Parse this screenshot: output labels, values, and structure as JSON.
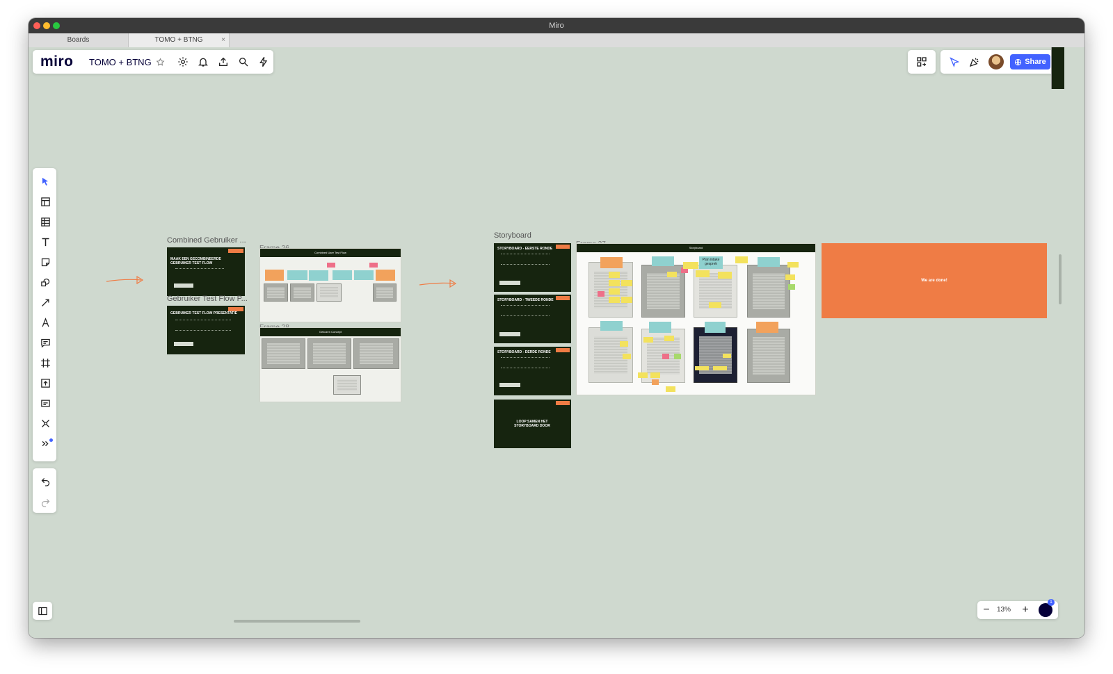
{
  "window": {
    "title": "Miro"
  },
  "tabs": [
    {
      "label": "Boards",
      "active": false
    },
    {
      "label": "TOMO + BTNG",
      "active": true,
      "close": "×"
    }
  ],
  "header": {
    "logo": "miro",
    "board_name": "TOMO + BTNG",
    "icons": [
      "star-icon",
      "settings-icon",
      "bell-icon",
      "upload-icon",
      "search-icon",
      "magic-icon"
    ]
  },
  "top_right": {
    "share_label": "Share",
    "icons": [
      "apps-icon",
      "cursor-arrow-icon",
      "celebrate-icon",
      "avatar",
      "globe-icon"
    ]
  },
  "toolbar": {
    "tools": [
      "select-icon",
      "templates-icon",
      "table-icon",
      "text-icon",
      "sticky-note-icon",
      "shapes-icon",
      "connector-icon",
      "pen-icon",
      "comment-icon",
      "frame-icon",
      "upload-icon",
      "card-icon",
      "mindmap-icon",
      "more-tools-icon"
    ],
    "undo": "undo-icon",
    "redo": "redo-icon"
  },
  "canvas": {
    "frame1_label": "Combined Gebruiker ...",
    "slide1_title": "MAAK EEN GECOMBINEERDE GEBRUIKER TEST FLOW",
    "frame2_label": "Gebruiker Test Flow P...",
    "slide2_title": "GEBRUIKER TEST FLOW PRESENTATIE",
    "frame26_label": "Frame 26",
    "frame26_header": "Combined User Test Flow",
    "frame28_label": "Frame 28",
    "frame28_header": "Gekozen Concept",
    "storyboard_label": "Storyboard",
    "sb1_title": "STORYBOARD - EERSTE RONDE",
    "sb2_title": "STORYBOARD - TWEEDE RONDE",
    "sb3_title": "STORYBOARD - DERDE RONDE",
    "sb4_title": "LOOP SAMEN HET STORYBOARD DOOR",
    "frame27_label": "Frame 27",
    "frame27_header": "Storyboard",
    "plan_sticky": "Plan intake gesprek",
    "done_text": "We are done!"
  },
  "zoom": {
    "level": "13%",
    "minus": "−",
    "plus": "+",
    "notifications": "1"
  },
  "colors": {
    "canvas": "#cfd9cf",
    "dark_slide": "#16240f",
    "accent_orange": "#ef7c45",
    "share_blue": "#4262ff"
  }
}
